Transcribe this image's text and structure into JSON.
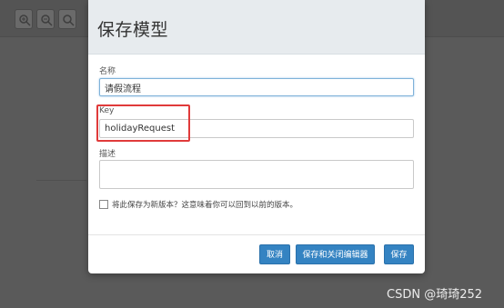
{
  "modal": {
    "title": "保存模型",
    "name_label": "名称",
    "name_value": "请假流程",
    "key_label": "Key",
    "key_value": "holidayRequest",
    "description_label": "描述",
    "description_value": "",
    "new_version_label": "将此保存为新版本？这意味着你可以回到以前的版本。",
    "new_version_checked": false
  },
  "buttons": {
    "cancel": "取消",
    "save_and_close": "保存和关闭编辑器",
    "save": "保存"
  },
  "toolbar": {
    "icons": [
      "zoom-in-icon",
      "zoom-out-icon",
      "zoom-actual-icon"
    ]
  },
  "colors": {
    "primary_button": "#3483c2",
    "header_bg": "#e7ebee",
    "highlight": "#e03a3a",
    "backdrop": "#5a5a5a"
  },
  "watermark": "CSDN @琦琦252"
}
